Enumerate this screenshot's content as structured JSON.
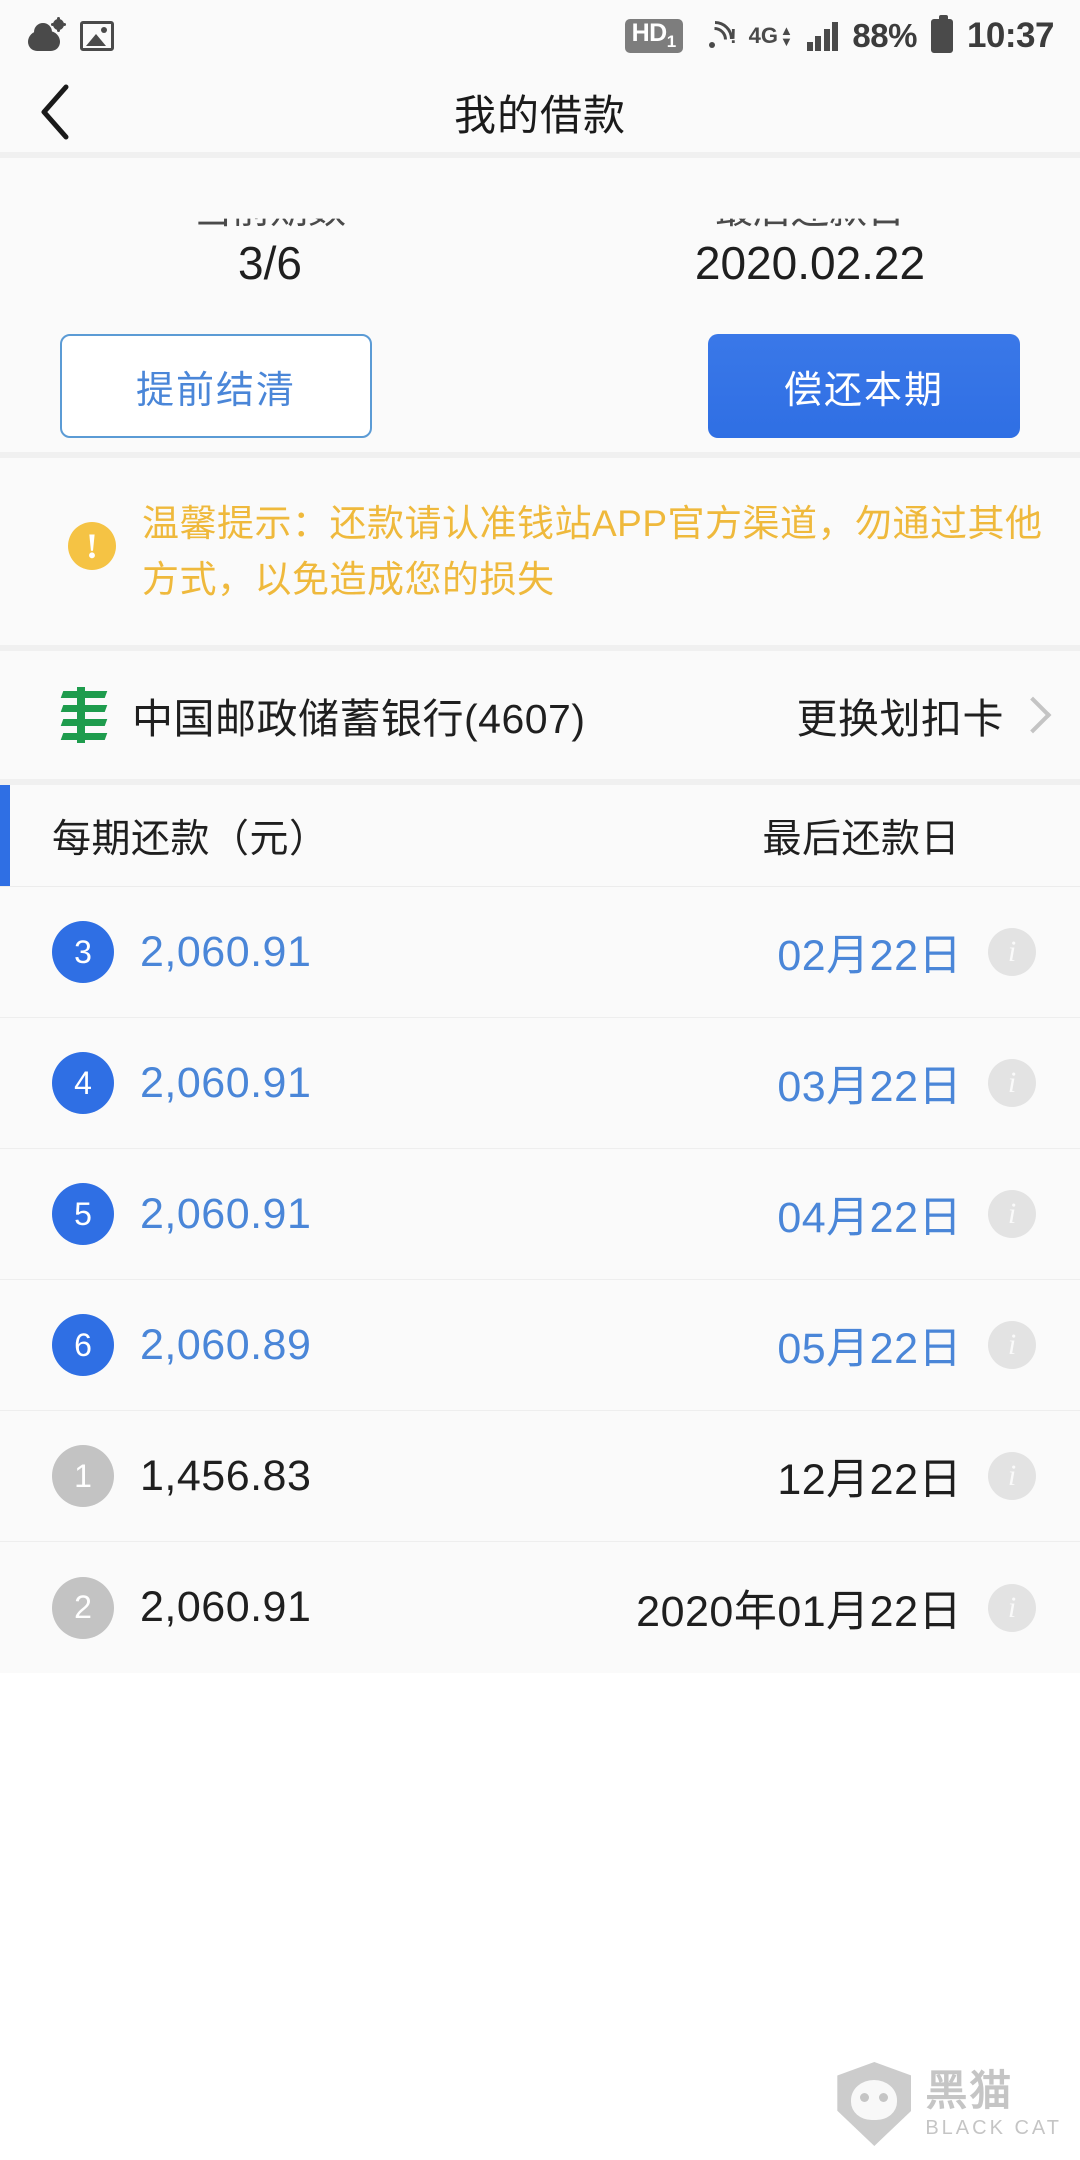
{
  "status_bar": {
    "left_icons": [
      "weather-cloud-sun-icon",
      "image-icon"
    ],
    "hd_badge": "HD",
    "hd_badge_sub": "1",
    "network": "4G",
    "battery_percent": "88%",
    "time": "10:37"
  },
  "nav": {
    "back_icon": "chevron-left-icon",
    "title": "我的借款"
  },
  "summary": {
    "clipped_label_left": "当前期数",
    "clipped_label_right": "最后还款日",
    "period": "3/6",
    "due_date": "2020.02.22",
    "settle_early_label": "提前结清",
    "repay_current_label": "偿还本期"
  },
  "tip": {
    "icon": "!",
    "text": "温馨提示：还款请认准钱站APP官方渠道，勿通过其他方式，以免造成您的损失"
  },
  "bank": {
    "logo": "china-post-savings-bank-logo",
    "name": "中国邮政储蓄银行(4607)",
    "change_card_label": "更换划扣卡",
    "chevron": "chevron-right-icon"
  },
  "table": {
    "header": {
      "amount": "每期还款（元）",
      "date": "最后还款日"
    },
    "rows": [
      {
        "num": "3",
        "amount": "2,060.91",
        "date": "02月22日",
        "state": "active",
        "info_icon": "info-icon"
      },
      {
        "num": "4",
        "amount": "2,060.91",
        "date": "03月22日",
        "state": "active",
        "info_icon": "info-icon"
      },
      {
        "num": "5",
        "amount": "2,060.91",
        "date": "04月22日",
        "state": "active",
        "info_icon": "info-icon"
      },
      {
        "num": "6",
        "amount": "2,060.89",
        "date": "05月22日",
        "state": "active",
        "info_icon": "info-icon"
      },
      {
        "num": "1",
        "amount": "1,456.83",
        "date": "12月22日",
        "state": "done",
        "info_icon": "info-icon"
      },
      {
        "num": "2",
        "amount": "2,060.91",
        "date": "2020年01月22日",
        "state": "done",
        "info_icon": "info-icon"
      }
    ]
  },
  "watermark": {
    "cn": "黑猫",
    "en": "BLACK CAT"
  },
  "colors": {
    "primary_blue": "#2f6fe4",
    "link_blue": "#4a86d8",
    "warning_yellow": "#efb93c",
    "bank_green": "#1e9c4d",
    "muted_gray": "#c3c3c3"
  }
}
